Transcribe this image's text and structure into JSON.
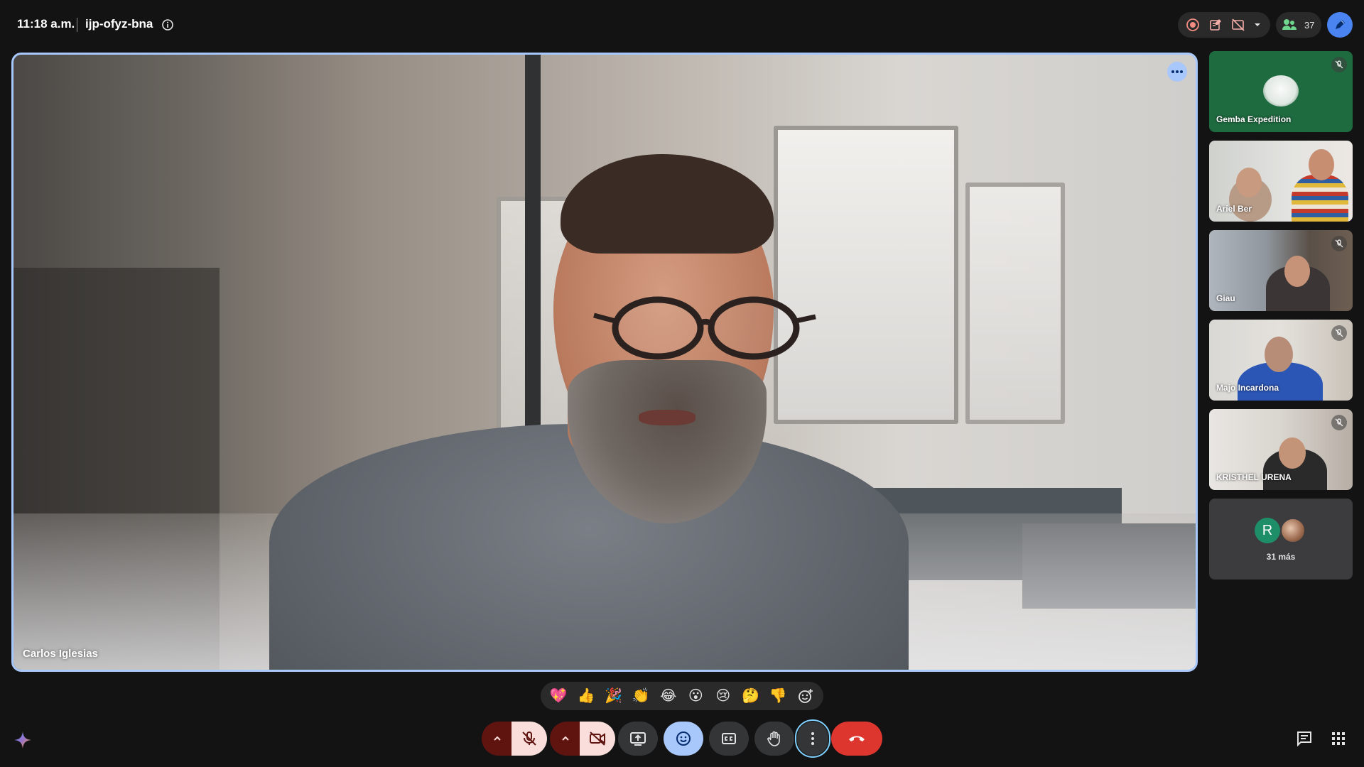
{
  "header": {
    "time": "11:18 a.m.",
    "meeting_code": "ijp-ofyz-bna",
    "participant_count": "37"
  },
  "main_video": {
    "speaker_name": "Carlos Iglesias"
  },
  "participants": [
    {
      "name": "Gemba Expedition",
      "muted": true
    },
    {
      "name": "Ariel Ber",
      "muted": false
    },
    {
      "name": "Giau",
      "muted": true
    },
    {
      "name": "Majo Incardona",
      "muted": true
    },
    {
      "name": "KRISTHEL URENA",
      "muted": true
    }
  ],
  "more_participants": {
    "avatar_letter": "R",
    "label": "31 más"
  },
  "reactions": [
    "💖",
    "👍",
    "🎉",
    "👏",
    "😂",
    "😮",
    "😢",
    "🤔",
    "👎"
  ],
  "colors": {
    "accent": "#a8c7fa",
    "end_call": "#dc362e",
    "muted_bg": "#f9dedc",
    "muted_dark": "#601410",
    "tile_green": "#1f6b40"
  },
  "icons": {
    "top_right": [
      "record-icon",
      "activities-icon",
      "captions-off-icon",
      "chevron-down-icon",
      "people-icon",
      "pen-icon"
    ],
    "controls": [
      "chevron-up-icon",
      "mic-off-icon",
      "chevron-up-icon",
      "camera-off-icon",
      "present-icon",
      "emoji-icon",
      "captions-icon",
      "raise-hand-icon",
      "more-vert-icon",
      "call-end-icon"
    ],
    "bottom_right": [
      "chat-icon",
      "apps-icon"
    ]
  }
}
